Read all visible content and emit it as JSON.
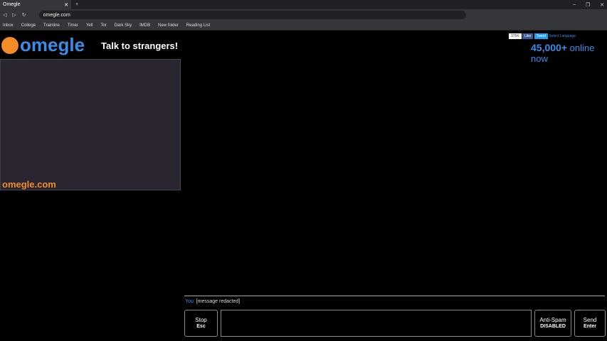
{
  "browser": {
    "tab_title": "Omegle",
    "url": "omegle.com",
    "bookmarks": [
      "Inbox",
      "College",
      "Trainline",
      "Timer",
      "Yell",
      "Tor",
      "Dark Sky",
      "IMDB",
      "New folder",
      "Reading List"
    ]
  },
  "header": {
    "logo": "omegle",
    "tagline": "Talk to strangers!",
    "like_count": "375K",
    "like_label": "Like",
    "tweet_label": "Tweet",
    "language_label": "Select Language",
    "online_count": "45,000+",
    "online_label": "online now"
  },
  "video": {
    "watermark": "omegle.com",
    "notice": ""
  },
  "chat": {
    "sender": "You:",
    "message": "[message redacted]"
  },
  "controls": {
    "stop": "Stop",
    "stop_key": "Esc",
    "antispam": "Anti-Spam",
    "antispam_state": "DISABLED",
    "send": "Send",
    "send_key": "Enter"
  }
}
